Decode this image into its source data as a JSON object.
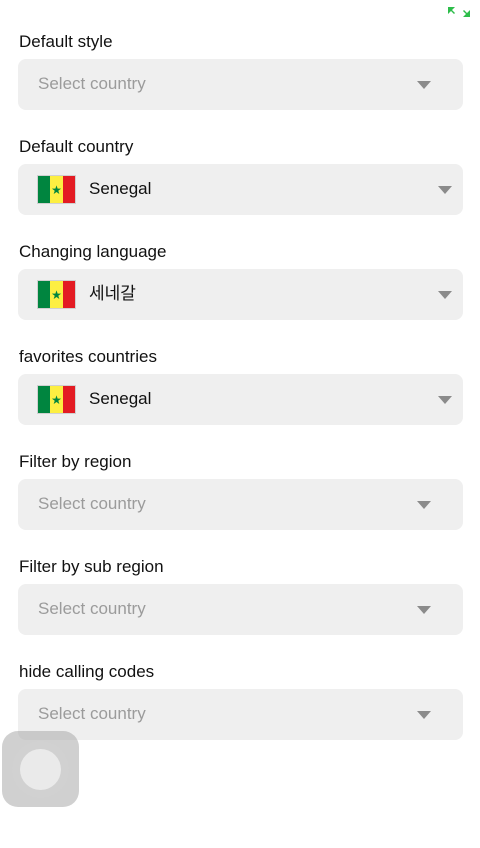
{
  "status_bar": {
    "expand_icon": "fullscreen-expand-icon",
    "accent_color": "#2dbd4a"
  },
  "sections": [
    {
      "label": "Default style",
      "placeholder": "Select country"
    },
    {
      "label": "Default country",
      "value": "Senegal",
      "flag_icon": "senegal-flag-icon"
    },
    {
      "label": "Changing language",
      "value": "세네갈",
      "flag_icon": "senegal-flag-icon"
    },
    {
      "label": "favorites countries",
      "value": "Senegal",
      "flag_icon": "senegal-flag-icon"
    },
    {
      "label": "Filter by region",
      "placeholder": "Select country"
    },
    {
      "label": "Filter by sub region",
      "placeholder": "Select country"
    },
    {
      "label": "hide calling codes",
      "placeholder": "Select country"
    }
  ],
  "dropdown_icon": "caret-down-icon",
  "assistive_touch_icon": "assistive-touch-icon",
  "colors": {
    "dropdown_background": "#efefef",
    "placeholder_text": "#9b9b9b",
    "caret": "#8b8b8b",
    "flag_green": "#00853f",
    "flag_yellow": "#fdef42",
    "flag_red": "#e31b23"
  }
}
